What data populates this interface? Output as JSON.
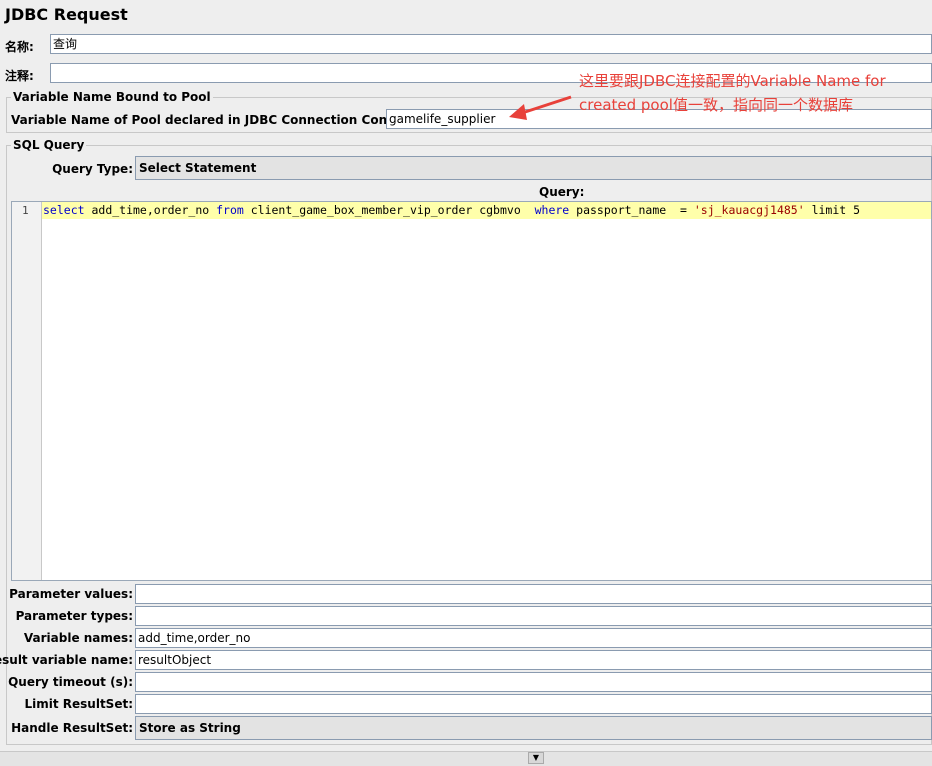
{
  "title": "JDBC Request",
  "name_label": "名称:",
  "name_value": "查询",
  "comment_label": "注释:",
  "comment_value": "",
  "pool_section": {
    "legend": "Variable Name Bound to Pool",
    "label": "Variable Name of Pool declared in JDBC Connection Configuration:",
    "value": "gamelife_supplier"
  },
  "annotation": {
    "line1": "这里要跟JDBC连接配置的Variable Name for",
    "line2": "created pool值一致，指向同一个数据库",
    "color": "#e8413a"
  },
  "sql_section": {
    "legend": "SQL Query",
    "query_type_label": "Query Type:",
    "query_type_value": "Select Statement",
    "query_label": "Query:",
    "line_number": "1",
    "code": {
      "kw_select": "select",
      "t1": " add_time,order_no ",
      "kw_from": "from",
      "t2": " client_game_box_member_vip_order cgbmvo  ",
      "kw_where": "where",
      "t3": " passport_name  = ",
      "str": "'sj_kauacgj1485'",
      "t4": " limit ",
      "num": "5"
    }
  },
  "params": {
    "parameter_values_label": "Parameter values:",
    "parameter_values": "",
    "parameter_types_label": "Parameter types:",
    "parameter_types": "",
    "variable_names_label": "Variable names:",
    "variable_names": "add_time,order_no",
    "result_variable_label": "Result variable name:",
    "result_variable": "resultObject",
    "query_timeout_label": "Query timeout (s):",
    "query_timeout": "",
    "limit_resultset_label": "Limit ResultSet:",
    "limit_resultset": "",
    "handle_resultset_label": "Handle ResultSet:",
    "handle_resultset": "Store as String"
  }
}
